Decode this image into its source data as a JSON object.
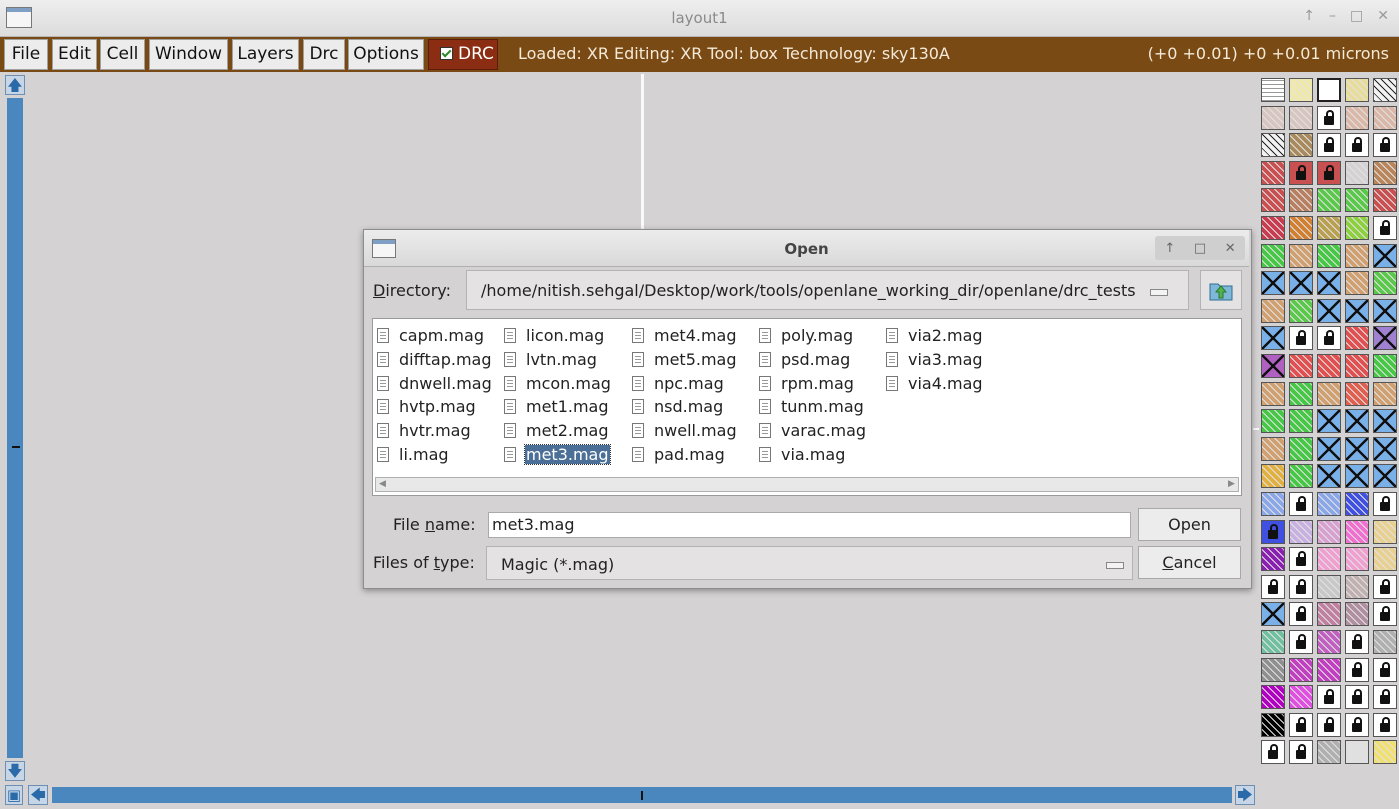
{
  "window": {
    "title": "layout1",
    "controls": [
      "↑",
      "–",
      "□",
      "✕"
    ]
  },
  "menubar": {
    "items": [
      "File",
      "Edit",
      "Cell",
      "Window",
      "Layers",
      "Drc",
      "Options"
    ],
    "drc_toggle": {
      "label": "DRC",
      "checked": true
    },
    "status": "Loaded: XR Editing: XR Tool: box  Technology: sky130A",
    "coords": "(+0 +0.01) +0 +0.01 microns"
  },
  "dialog": {
    "title": "Open",
    "controls": [
      "↑",
      "□",
      "✕"
    ],
    "directory_label_u": "D",
    "directory_label_rest": "irectory:",
    "directory_path": "/home/nitish.sehgal/Desktop/work/tools/openlane_working_dir/openlane/drc_tests",
    "files": [
      [
        "capm.mag",
        "difftap.mag",
        "dnwell.mag",
        "hvtp.mag",
        "hvtr.mag",
        "li.mag"
      ],
      [
        "licon.mag",
        "lvtn.mag",
        "mcon.mag",
        "met1.mag",
        "met2.mag",
        "met3.mag"
      ],
      [
        "met4.mag",
        "met5.mag",
        "npc.mag",
        "nsd.mag",
        "nwell.mag",
        "pad.mag"
      ],
      [
        "poly.mag",
        "psd.mag",
        "rpm.mag",
        "tunm.mag",
        "varac.mag",
        "via.mag"
      ],
      [
        "via2.mag",
        "via3.mag",
        "via4.mag"
      ]
    ],
    "selected_file": "met3.mag",
    "file_name_label_a": "File ",
    "file_name_label_u": "n",
    "file_name_label_b": "ame:",
    "file_name_value": "met3.mag",
    "files_of_type_label_a": "Files of ",
    "files_of_type_label_u": "t",
    "files_of_type_label_b": "ype:",
    "files_of_type_value": "Magic (*.mag)",
    "open_button": "Open",
    "cancel_button_u": "C",
    "cancel_button_rest": "ancel"
  },
  "colors": {
    "menubar": "#7a4a14",
    "drc": "#8a2d12",
    "scrollbar": "#4a87be",
    "selection": "#4b6f96"
  }
}
